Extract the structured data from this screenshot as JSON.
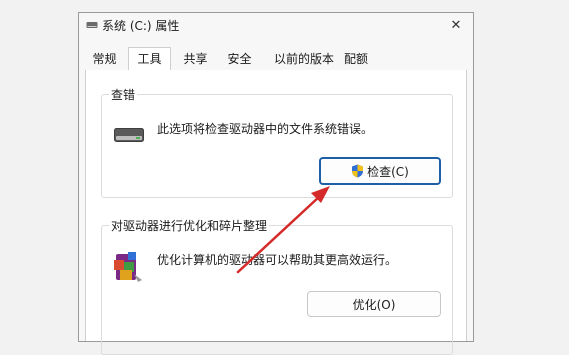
{
  "window": {
    "title": "系统 (C:) 属性",
    "close_glyph": "✕"
  },
  "tabs": [
    {
      "label": "常规",
      "active": false
    },
    {
      "label": "工具",
      "active": true
    },
    {
      "label": "共享",
      "active": false
    },
    {
      "label": "安全",
      "active": false
    },
    {
      "label": "以前的版本",
      "active": false
    },
    {
      "label": "配额",
      "active": false
    }
  ],
  "error_checking": {
    "title": "查错",
    "description": "此选项将检查驱动器中的文件系统错误。",
    "button_label": "检查(C)",
    "icon": "drive-icon",
    "button_icon": "shield-icon"
  },
  "optimize": {
    "title": "对驱动器进行优化和碎片整理",
    "description": "优化计算机的驱动器可以帮助其更高效运行。",
    "button_label": "优化(O)",
    "icon": "defrag-icon"
  },
  "colors": {
    "annotation_arrow": "#d42a2a",
    "focus_border": "#1f5fa8"
  }
}
